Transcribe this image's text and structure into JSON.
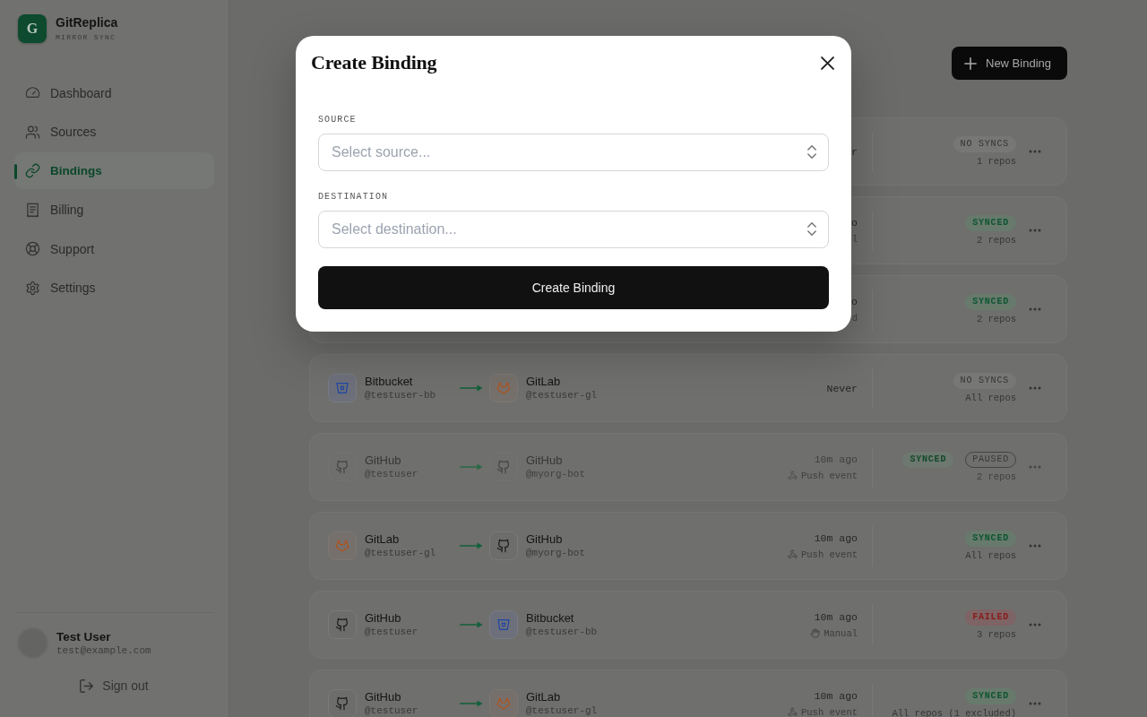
{
  "sidebar": {
    "brand": {
      "logo_letter": "G",
      "name": "GitReplica",
      "tagline": "MIRROR SYNC"
    },
    "nav": [
      {
        "kind": "dashboard",
        "label": "Dashboard",
        "selected": false
      },
      {
        "kind": "sources",
        "label": "Sources",
        "selected": false
      },
      {
        "kind": "bindings",
        "label": "Bindings",
        "selected": true
      },
      {
        "kind": "billing",
        "label": "Billing",
        "selected": false
      },
      {
        "kind": "support",
        "label": "Support",
        "selected": false
      },
      {
        "kind": "settings",
        "label": "Settings",
        "selected": false
      }
    ],
    "user": {
      "name": "Test User",
      "email": "test@example.com"
    },
    "sign_out": "Sign out"
  },
  "header": {
    "new_binding_button": "New Binding"
  },
  "bindings": [
    {
      "time": "r",
      "status": {
        "kind": "no_syncs",
        "label": "NO SYNCS"
      },
      "paused": false,
      "repos": "1 repos"
    },
    {
      "time": "o",
      "trigger": {
        "label": "l"
      },
      "status": {
        "kind": "synced",
        "label": "SYNCED"
      },
      "paused": false,
      "repos": "2 repos"
    },
    {
      "time": "o",
      "trigger": {
        "label": "d"
      },
      "status": {
        "kind": "synced",
        "label": "SYNCED"
      },
      "paused": false,
      "repos": "2 repos"
    },
    {
      "source": {
        "kind": "bitbucket",
        "name": "Bitbucket",
        "handle": "@testuser-bb"
      },
      "destination": {
        "kind": "gitlab",
        "name": "GitLab",
        "handle": "@testuser-gl"
      },
      "time": "Never",
      "status": {
        "kind": "no_syncs",
        "label": "NO SYNCS"
      },
      "paused": false,
      "repos": "All repos"
    },
    {
      "source": {
        "kind": "github",
        "name": "GitHub",
        "handle": "@testuser"
      },
      "destination": {
        "kind": "github",
        "name": "GitHub",
        "handle": "@myorg-bot"
      },
      "time": "10m ago",
      "trigger": {
        "kind": "push",
        "label": "Push event"
      },
      "status": {
        "kind": "synced",
        "label": "SYNCED"
      },
      "paused": true,
      "paused_badge": "PAUSED",
      "repos": "2 repos"
    },
    {
      "source": {
        "kind": "gitlab",
        "name": "GitLab",
        "handle": "@testuser-gl"
      },
      "destination": {
        "kind": "github",
        "name": "GitHub",
        "handle": "@myorg-bot"
      },
      "time": "10m ago",
      "trigger": {
        "kind": "push",
        "label": "Push event"
      },
      "status": {
        "kind": "synced",
        "label": "SYNCED"
      },
      "paused": false,
      "repos": "All repos"
    },
    {
      "source": {
        "kind": "github",
        "name": "GitHub",
        "handle": "@testuser"
      },
      "destination": {
        "kind": "bitbucket",
        "name": "Bitbucket",
        "handle": "@testuser-bb"
      },
      "time": "10m ago",
      "trigger": {
        "kind": "manual",
        "label": "Manual"
      },
      "status": {
        "kind": "failed",
        "label": "FAILED"
      },
      "paused": false,
      "repos": "3 repos"
    },
    {
      "source": {
        "kind": "github",
        "name": "GitHub",
        "handle": "@testuser"
      },
      "destination": {
        "kind": "gitlab",
        "name": "GitLab",
        "handle": "@testuser-gl"
      },
      "time": "10m ago",
      "trigger": {
        "kind": "push",
        "label": "Push event"
      },
      "status": {
        "kind": "synced",
        "label": "SYNCED"
      },
      "paused": false,
      "repos": "All repos (1 excluded)"
    }
  ],
  "modal": {
    "title": "Create Binding",
    "fields": [
      {
        "label": "SOURCE",
        "placeholder": "Select source..."
      },
      {
        "label": "DESTINATION",
        "placeholder": "Select destination..."
      }
    ],
    "submit_button": "Create Binding"
  }
}
